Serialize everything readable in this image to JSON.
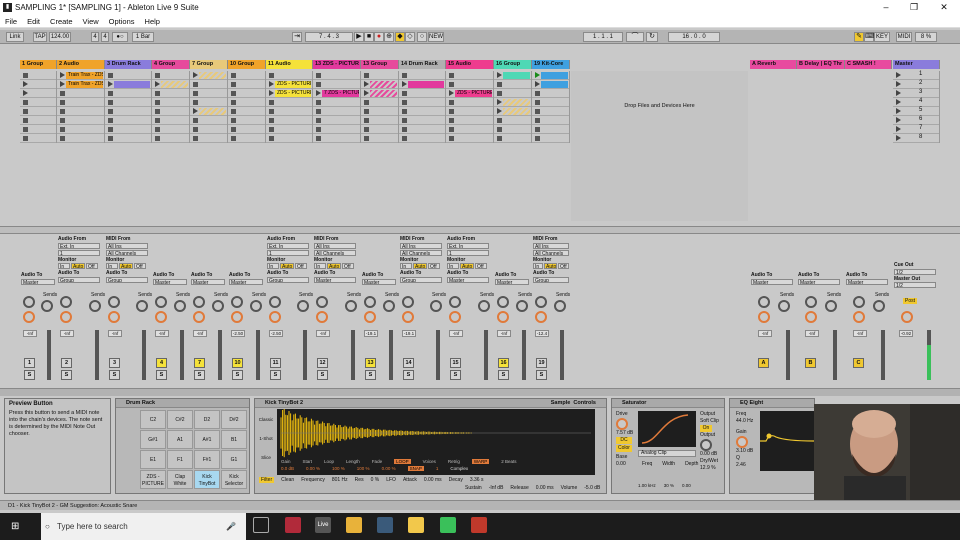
{
  "window": {
    "title": "SAMPLING 1* [SAMPLING 1] - Ableton Live 9 Suite",
    "minimize": "–",
    "maximize": "❐",
    "close": "✕"
  },
  "menu": [
    "File",
    "Edit",
    "Create",
    "View",
    "Options",
    "Help"
  ],
  "transport": {
    "link": "Link",
    "tap": "TAP",
    "tempo": "124.00",
    "sig_num": "4",
    "sig_den": "4",
    "quant": "1 Bar",
    "position": "7 . 4 . 3",
    "loop_start": "1 . 1 . 1",
    "loop_length": "16 . 0 . 0",
    "new": "NEW",
    "key": "KEY",
    "midi": "MIDI",
    "cpu": "8 %"
  },
  "tracks": [
    {
      "name": "1 Group",
      "color": "#f0a32a"
    },
    {
      "name": "2 Audio",
      "color": "#f0a32a"
    },
    {
      "name": "3 Drum Rack",
      "color": "#8a7cdc"
    },
    {
      "name": "4 Group",
      "color": "#e64a9c"
    },
    {
      "name": "7 Group",
      "color": "#e8c97a"
    },
    {
      "name": "10 Group",
      "color": "#f0a32a"
    },
    {
      "name": "11 Audio",
      "color": "#f5e23a"
    },
    {
      "name": "13 ZDS - PICTUR",
      "color": "#e2399d"
    },
    {
      "name": "13 Group",
      "color": "#e64a9c"
    },
    {
      "name": "14 Drum Rack",
      "color": "#b0b0b0"
    },
    {
      "name": "15 Audio",
      "color": "#ee3c8e"
    },
    {
      "name": "16 Group",
      "color": "#4fd8b5"
    },
    {
      "name": "19 Kit-Core",
      "color": "#3fa0e0"
    }
  ],
  "returns": [
    {
      "name": "A Reverb",
      "color": "#e84a9f"
    },
    {
      "name": "B Delay | EQ Thr",
      "color": "#e84a9f"
    },
    {
      "name": "C SMASH !",
      "color": "#e84a9f"
    },
    {
      "name": "Master",
      "color": "#8a7cdc"
    }
  ],
  "clips": {
    "train_trax_1": "Train Trax - ZDS",
    "train_trax_2": "Train Trax - ZDS",
    "zds_picture_1": "ZDS - PICTURE",
    "zds_picture_2": "ZDS - PICTURE",
    "zds_picture_3": "7 ZDS - PICTUR",
    "zds_picture_4": "ZDS - PICTURE"
  },
  "drop_zone": "Drop Files and Devices Here",
  "scenes": [
    "1",
    "2",
    "3",
    "4",
    "5",
    "6",
    "7",
    "8"
  ],
  "io": {
    "audio_from": "Audio From",
    "midi_from": "MIDI From",
    "ext_in": "Ext. In",
    "all_ins": "All Ins",
    "all_channels": "All Channels",
    "monitor": "Monitor",
    "in": "In",
    "auto": "Auto",
    "off": "Off",
    "audio_to": "Audio To",
    "master": "Master",
    "group": "Group",
    "sends": "Sends",
    "cue_out": "Cue Out",
    "master_out": "Master Out",
    "cue_val": "1/2",
    "master_val": "1/2",
    "post": "Post"
  },
  "mixer": {
    "volumes": [
      "-Inf",
      "-Inf",
      "-Inf",
      "-Inf",
      "-Inf",
      "-2.50",
      "-2.50",
      "-Inf",
      "-19.1",
      "-19.1",
      "-Inf",
      "-Inf",
      "-12.4"
    ],
    "track_numbers": [
      "1",
      "2",
      "3",
      "4",
      "7",
      "10",
      "11",
      "12",
      "13",
      "14",
      "15",
      "16",
      "19"
    ],
    "return_letters": [
      "A",
      "B",
      "C"
    ],
    "return_volumes": [
      "-Inf",
      "-Inf",
      "-Inf"
    ],
    "master_volume": "-0.92",
    "scale": [
      "12",
      "24",
      "36",
      "48",
      "60"
    ]
  },
  "preview": {
    "title": "Preview Button",
    "text": "Press this button to send a MIDI note into the chain's devices. The note sent is determined by the MIDI Note Out chooser."
  },
  "drum_rack": {
    "title": "Drum Rack",
    "pads": [
      [
        "C2",
        "C#2",
        "D2",
        "D#2"
      ],
      [
        "G#1",
        "A1",
        "A#1",
        "B1"
      ],
      [
        "E1",
        "F1",
        "F#1",
        "G1"
      ],
      [
        "ZDS - PICTURE",
        "Clap White",
        "Kick TinyBot",
        "Kick Selector"
      ]
    ]
  },
  "simpler": {
    "title": "Kick TinyBot 2",
    "sample": "Sample",
    "controls": "Controls",
    "classic": "Classic",
    "one_shot": "1-Shot",
    "slice": "Slice",
    "gain": "Gain",
    "start": "Start",
    "loop": "Loop",
    "length": "Length",
    "fade": "Fade",
    "loop_btn": "LOOP",
    "voices": "Voices",
    "retrig": "Retrig",
    "warp": "WARP",
    "beats": "2 Beats",
    "snap": "SNAP",
    "complex": "Complex",
    "filter": "Filter",
    "frequency": "Frequency",
    "res": "Res",
    "lfo": "LFO",
    "attack": "Attack",
    "decay": "Decay",
    "sustain": "Sustain",
    "release": "Release",
    "volume": "Volume",
    "gain_val": "0.0 dB",
    "start_val": "0.00 %",
    "loop_val": "100 %",
    "length_val": "100 %",
    "fade_val": "0.00 %",
    "voices_val": "1",
    "attack_val": "0.00 ms",
    "decay_val": "3.36 s",
    "sustain_val": "-Inf dB",
    "release_val": "0.00 ms",
    "volume_val": "-5.0 dB",
    "freq_val": "801 Hz",
    "res_val": "0 %",
    "clean": "Clean"
  },
  "saturator": {
    "title": "Saturator",
    "drive": "Drive",
    "drive_val": "7.57 dB",
    "dc": "DC",
    "color": "Color",
    "analog_clip": "Analog Clip",
    "output": "Output",
    "soft_clip": "Soft Clip",
    "on": "On",
    "output_val": "0.00 dB",
    "base": "Base",
    "freq": "Freq",
    "width": "Width",
    "depth": "Depth",
    "drywet": "Dry/Wet",
    "base_val": "0.00",
    "freq_val": "1.00 kHz",
    "width_val": "30 %",
    "depth_val": "0.00",
    "drywet_val": "12.9 %"
  },
  "eq_eight": {
    "title": "EQ Eight",
    "freq": "Freq",
    "freq_val": "44.0 Hz",
    "gain": "Gain",
    "gain_val": "3.10 dB",
    "q": "Q",
    "q_val": "2.46"
  },
  "status_text": "D1 - Kick TinyBot 2 - GM Suggestion: Acoustic Snare",
  "taskbar": {
    "search_placeholder": "Type here to search"
  },
  "colors": {
    "orange": "#f0a32a",
    "yellow": "#f5e23a",
    "pink": "#e2399d",
    "purple": "#8a7cdc",
    "teal": "#4fd8b5",
    "blue": "#3fa0e0",
    "waveform": "#f2c10f",
    "panel_dark": "#1e1e1e"
  }
}
